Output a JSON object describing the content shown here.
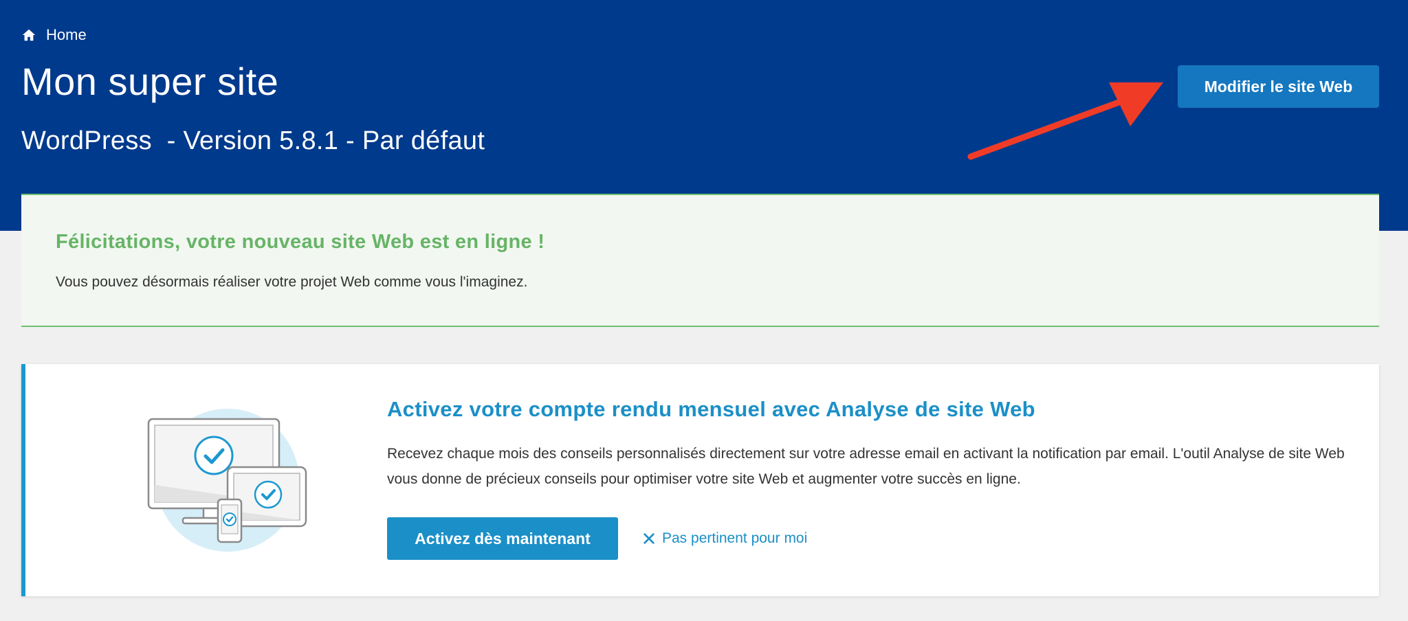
{
  "header": {
    "breadcrumb": {
      "icon": "home-icon",
      "label": "Home"
    },
    "title": "Mon super site",
    "subtitle": "WordPress  - Version 5.8.1 - Par défaut",
    "edit_button_label": "Modifier le site Web",
    "background_color": "#003a8c",
    "button_color": "#1577c0",
    "annotation_arrow_color": "#f03c27"
  },
  "success_banner": {
    "title": "Félicitations, votre nouveau site Web est en ligne !",
    "text": "Vous pouvez désormais réaliser votre projet Web comme vous l'imaginez.",
    "accent_color": "#66b466"
  },
  "promo_card": {
    "title": "Activez votre compte rendu mensuel avec Analyse de site Web",
    "text": "Recevez chaque mois des conseils personnalisés directement sur votre adresse email en activant la notification par email. L'outil Analyse de site Web vous donne de précieux conseils pour optimiser votre site Web et augmenter votre succès en ligne.",
    "primary_button_label": "Activez dès maintenant",
    "dismiss_label": "Pas pertinent pour moi",
    "dismiss_icon": "close-icon",
    "illustration": "devices-check-illustration",
    "accent_color": "#1b8fc7"
  }
}
